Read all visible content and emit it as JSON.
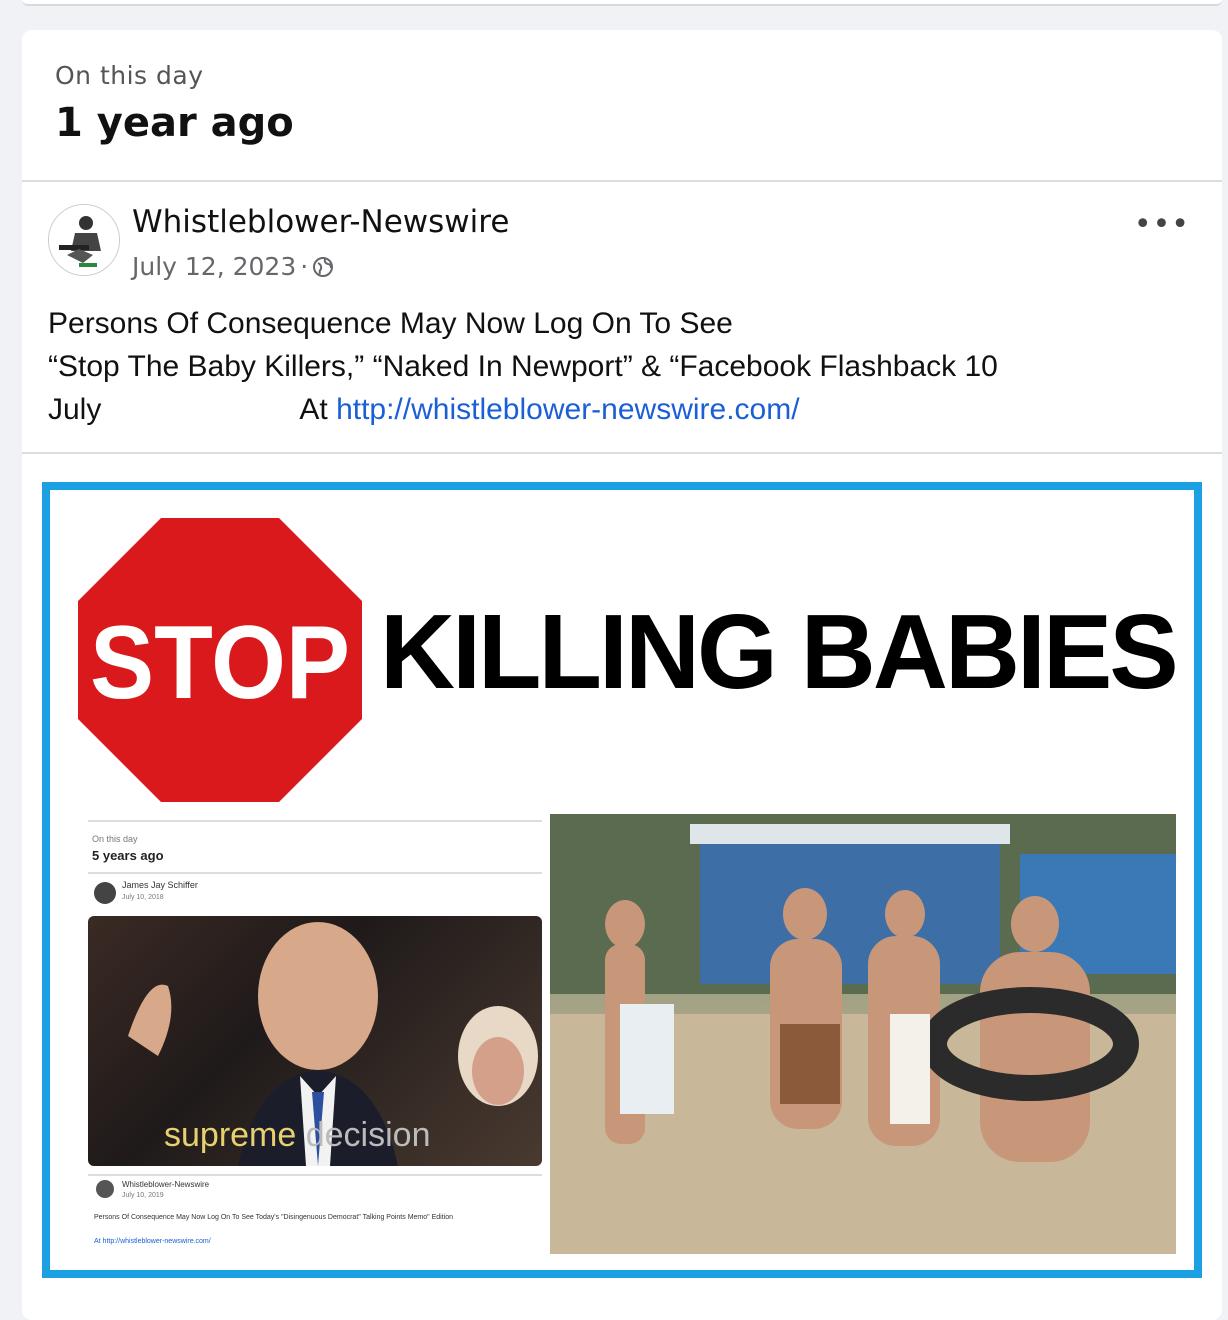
{
  "memory": {
    "eyebrow": "On this day",
    "title": "1 year ago"
  },
  "post": {
    "author": "Whistleblower-Newswire",
    "date": "July 12, 2023",
    "separator": "·",
    "text_line1": "Persons Of Consequence May Now Log On To See",
    "text_line2": "“Stop The Baby Killers,” “Naked In Newport” & “Facebook Flashback 10",
    "text_line3": "July",
    "text_at": "At",
    "link": "http://whistleblower-newswire.com/"
  },
  "image": {
    "stop_text": "STOP",
    "headline": "KILLING BABIES",
    "inset": {
      "eyebrow": "On this day",
      "title": "5 years ago",
      "author": "James Jay Schiffer",
      "date": "July 10, 2018",
      "caption_a": "supreme",
      "caption_b": "decision",
      "reshare_author": "Whistleblower-Newswire",
      "reshare_date": "July 10, 2019",
      "reshare_text": "Persons Of Consequence May Now Log On To See Today's \"Disingenuous Democrat\" Talking Points Memo\" Edition",
      "reshare_link": "At http://whistleblower-newswire.com/"
    }
  },
  "colors": {
    "frame": "#1ca0e4",
    "stop_red": "#d9191c",
    "link": "#1a5fd6"
  },
  "icons": [
    "globe-icon",
    "more-icon",
    "avatar-icon"
  ]
}
